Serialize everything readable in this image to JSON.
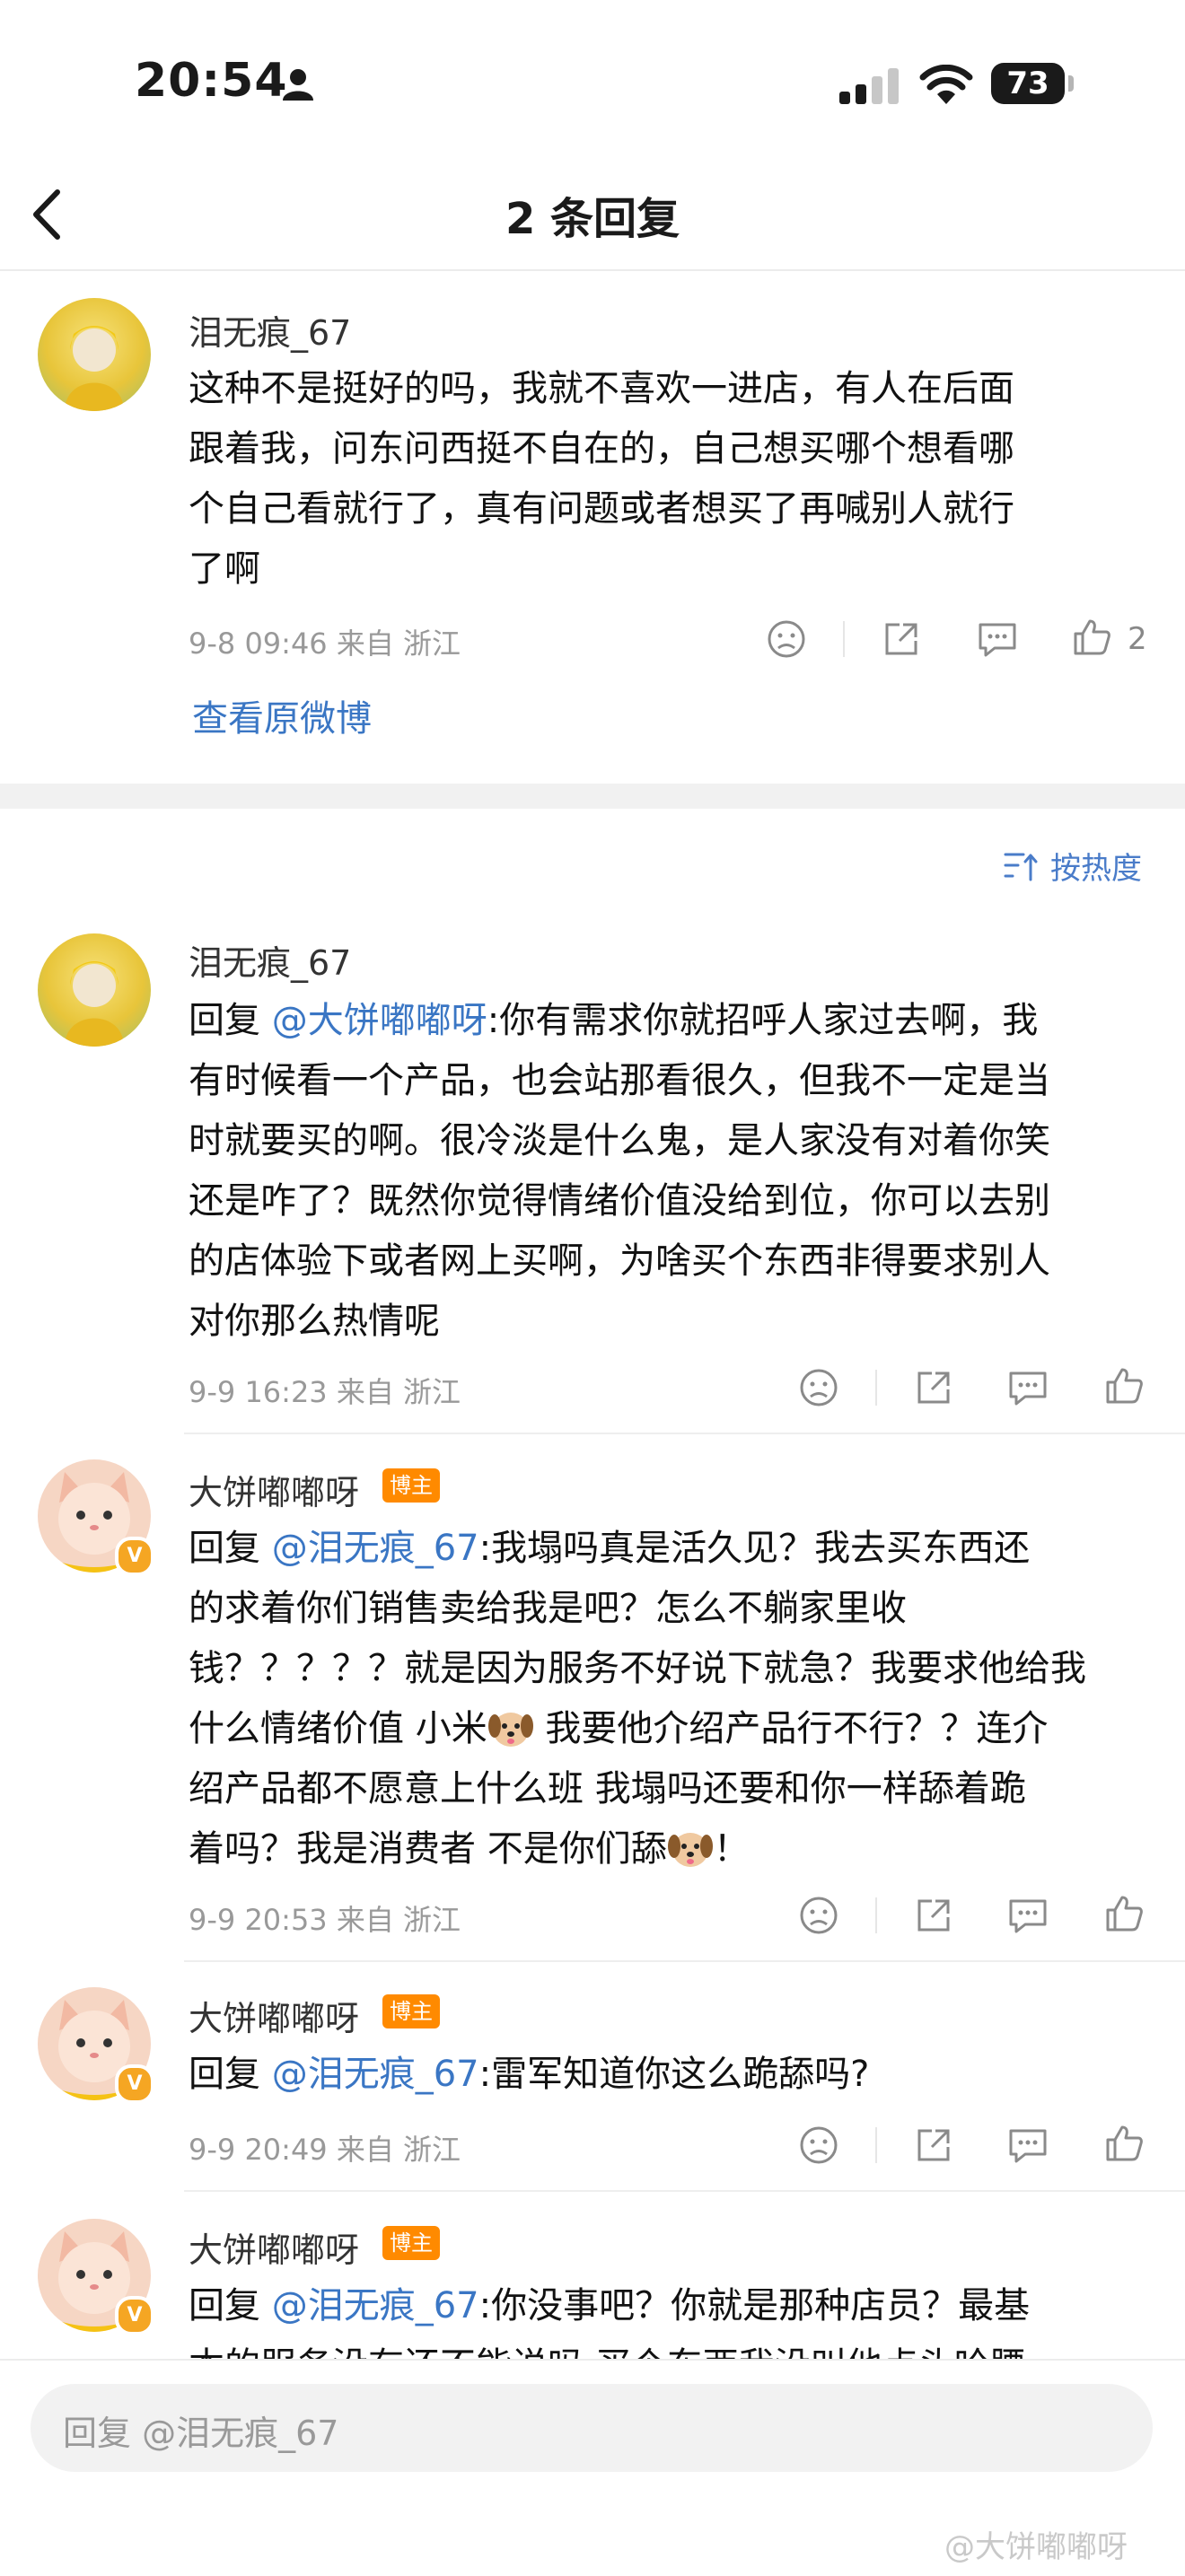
{
  "status_bar": {
    "time": "20:54",
    "battery": "73"
  },
  "nav": {
    "title": "2 条回复"
  },
  "original_comment": {
    "username": "泪无痕_67",
    "text": "这种不是挺好的吗，我就不喜欢一进店，有人在后面跟着我，问东问西挺不自在的，自己想买哪个想看哪个自己看就行了，真有问题或者想买了再喊别人就行了啊",
    "line1": "这种不是挺好的吗，我就不喜欢一进店，有人在后面",
    "line2": "跟着我，问东问西挺不自在的，自己想买哪个想看哪",
    "line3": "个自己看就行了，真有问题或者想买了再喊别人就行",
    "line4": "了啊",
    "meta": "9-8 09:46  来自 浙江",
    "like_count": "2",
    "view_original": "查看原微博"
  },
  "sort_label": "按热度",
  "replies": [
    {
      "username": "泪无痕_67",
      "reply_prefix": "回复 ",
      "mention": "@大饼嘟嘟呀",
      "l1": ":你有需求你就招呼人家过去啊，我",
      "l2": "有时候看一个产品，也会站那看很久，但我不一定是当",
      "l3": "时就要买的啊。很冷淡是什么鬼，是人家没有对着你笑",
      "l4": "还是咋了？既然你觉得情绪价值没给到位，你可以去别",
      "l5": "的店体验下或者网上买啊，为啥买个东西非得要求别人",
      "l6": "对你那么热情呢",
      "meta": "9-9 16:23  来自 浙江"
    },
    {
      "username": "大饼嘟嘟呀",
      "tag": "博主",
      "reply_prefix": "回复 ",
      "mention": "@泪无痕_67",
      "l1": ":我塌吗真是活久见？我去买东西还",
      "l2": "的求着你们销售卖给我是吧？怎么不躺家里收",
      "l3": "钱？？？？？就是因为服务不好说下就急？我要求他给我",
      "l4a": "什么情绪价值 小米",
      "l4b": " 我要他介绍产品行不行？？连介",
      "l5": "绍产品都不愿意上什么班 我塌吗还要和你一样舔着跪",
      "l6a": "着吗？我是消费者 不是你们舔",
      "l6b": "！",
      "meta": "9-9 20:53  来自 浙江"
    },
    {
      "username": "大饼嘟嘟呀",
      "tag": "博主",
      "reply_prefix": "回复 ",
      "mention": "@泪无痕_67",
      "l1": ":雷军知道你这么跪舔吗?",
      "meta": "9-9 20:49  来自 浙江"
    },
    {
      "username": "大饼嘟嘟呀",
      "tag": "博主",
      "reply_prefix": "回复 ",
      "mention": "@泪无痕_67",
      "l1": ":你没事吧？你就是那种店员？最基",
      "l2": "本的服务没有还不能说吗 买个东西我没叫他点头哈腰",
      "meta": ""
    }
  ],
  "input": {
    "placeholder": "回复 @泪无痕_67"
  },
  "watermark": "@大饼嘟嘟呀"
}
